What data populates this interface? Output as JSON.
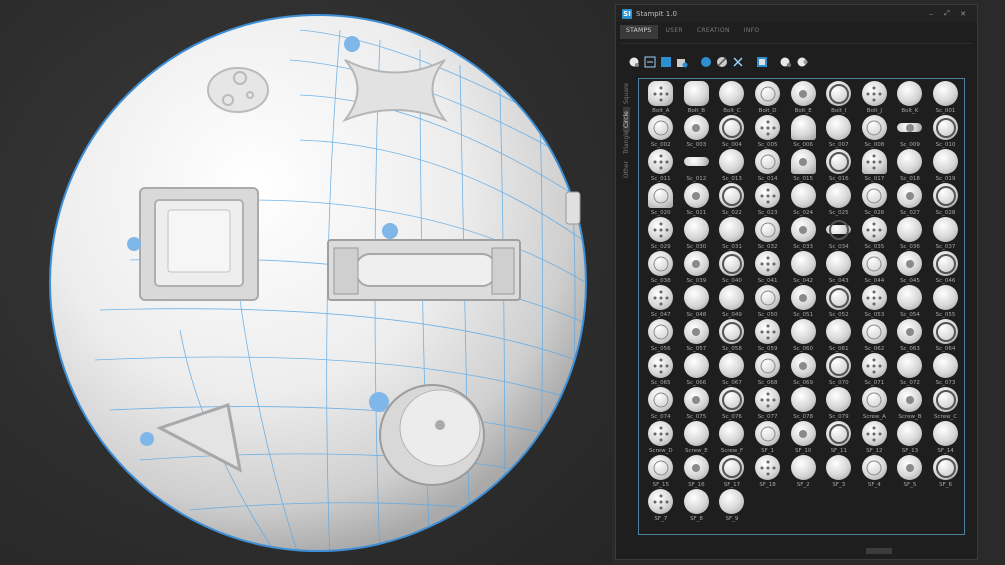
{
  "window": {
    "title": "StampIt 1.0",
    "logo_text": "SI",
    "min_label": "–",
    "max_label": "⤢",
    "close_label": "✕"
  },
  "tabs": [
    {
      "label": "STAMPS",
      "active": true
    },
    {
      "label": "USER",
      "active": false
    },
    {
      "label": "CREATION",
      "active": false
    },
    {
      "label": "INFO",
      "active": false
    }
  ],
  "side_tabs": [
    {
      "label": "Square",
      "active": false
    },
    {
      "label": "Circle",
      "active": true
    },
    {
      "label": "Triangle",
      "active": false
    },
    {
      "label": "Other",
      "active": false
    }
  ],
  "toolbar_icons": [
    "sphere-pin-icon",
    "frame-icon",
    "square-blue-icon",
    "cube-icon",
    "circle-blue-icon",
    "circle-slash-icon",
    "cross-icon",
    "stamp-icon",
    "sphere-small-icon",
    "sphere-add-icon"
  ],
  "stamps": [
    "Bolt_A",
    "Bolt_B",
    "Bolt_C",
    "Bolt_D",
    "Bolt_E",
    "Bolt_I",
    "Bolt_J",
    "Bolt_K",
    "Sc_001",
    "Sc_002",
    "Sc_003",
    "Sc_004",
    "Sc_005",
    "Sc_006",
    "Sc_007",
    "Sc_008",
    "Sc_009",
    "Sc_010",
    "Sc_011",
    "Sc_012",
    "Sc_013",
    "Sc_014",
    "Sc_015",
    "Sc_016",
    "Sc_017",
    "Sc_018",
    "Sc_019",
    "Sc_020",
    "Sc_021",
    "Sc_022",
    "Sc_023",
    "Sc_024",
    "Sc_025",
    "Sc_026",
    "Sc_027",
    "Sc_028",
    "Sc_029",
    "Sc_030",
    "Sc_031",
    "Sc_032",
    "Sc_033",
    "Sc_034",
    "Sc_035",
    "Sc_036",
    "Sc_037",
    "Sc_038",
    "Sc_039",
    "Sc_040",
    "Sc_041",
    "Sc_042",
    "Sc_043",
    "Sc_044",
    "Sc_045",
    "Sc_046",
    "Sc_047",
    "Sc_048",
    "Sc_049",
    "Sc_050",
    "Sc_051",
    "Sc_052",
    "Sc_053",
    "Sc_054",
    "Sc_055",
    "Sc_056",
    "Sc_057",
    "Sc_058",
    "Sc_059",
    "Sc_060",
    "Sc_061",
    "Sc_062",
    "Sc_063",
    "Sc_064",
    "Sc_065",
    "Sc_066",
    "Sc_067",
    "Sc_068",
    "Sc_069",
    "Sc_070",
    "Sc_071",
    "Sc_072",
    "Sc_073",
    "Sc_074",
    "Sc_075",
    "Sc_076",
    "Sc_077",
    "Sc_078",
    "Sc_079",
    "Screw_A",
    "Screw_B",
    "Screw_C",
    "Screw_D",
    "Screw_E",
    "Screw_F",
    "SF_1",
    "SF_10",
    "SF_11",
    "SF_12",
    "SF_13",
    "SF_14",
    "SF_15",
    "SF_16",
    "SF_17",
    "SF_18",
    "SF_2",
    "SF_3",
    "SF_4",
    "SF_5",
    "SF_6",
    "SF_7",
    "SF_8",
    "SF_9"
  ],
  "colors": {
    "accent": "#2b8fd0",
    "wire": "#5aa9e6",
    "panel_bg": "#1e1e1e",
    "grid_border": "#4d7fa0"
  }
}
